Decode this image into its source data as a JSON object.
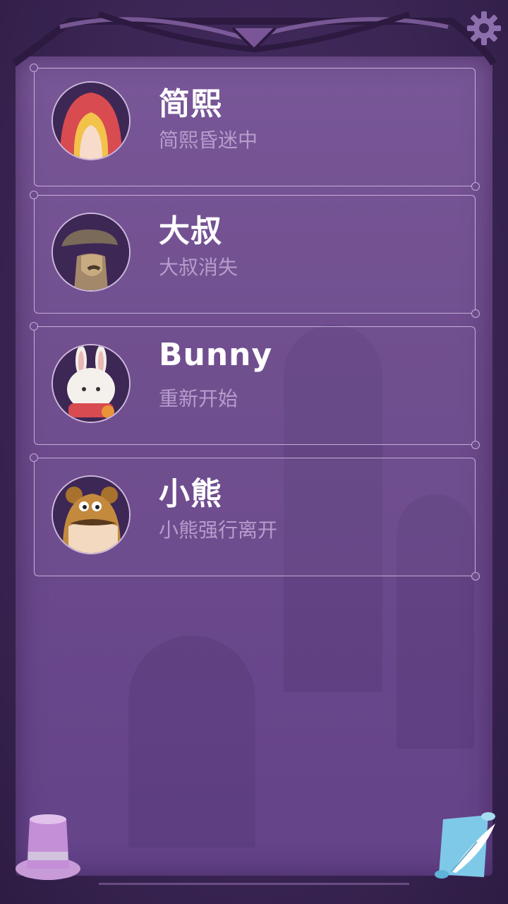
{
  "header": {
    "settings_icon": "gear-icon"
  },
  "saves": [
    {
      "name": "简熙",
      "status": "简熙昏迷中",
      "avatar_icon": "red-hood-girl-avatar"
    },
    {
      "name": "大叔",
      "status": "大叔消失",
      "avatar_icon": "uncle-flat-cap-avatar"
    },
    {
      "name": "Bunny",
      "status": "重新开始",
      "avatar_icon": "white-bunny-avatar"
    },
    {
      "name": "小熊",
      "status": "小熊强行离开",
      "avatar_icon": "bear-avatar"
    }
  ],
  "footer": {
    "left_icon": "top-hat-icon",
    "right_icon": "scroll-quill-icon"
  },
  "colors": {
    "panel": "#6e4b8c",
    "frame": "#3a2553",
    "name_text": "#ffffff",
    "status_text": "#b89ccc"
  }
}
